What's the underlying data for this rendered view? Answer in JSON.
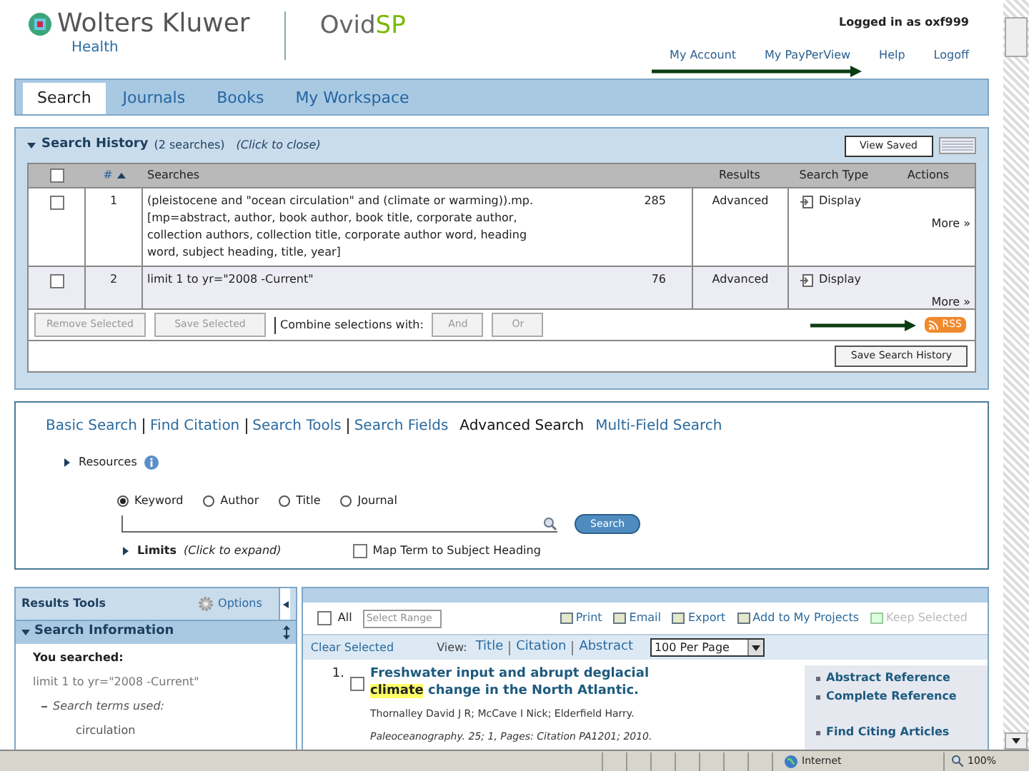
{
  "header": {
    "brand": "Wolters Kluwer",
    "division": "Health",
    "product": {
      "name": "Ovid",
      "suffix": "SP"
    },
    "logged_in": "Logged in as oxf999",
    "links": [
      "My Account",
      "My PayPerView",
      "Help",
      "Logoff"
    ]
  },
  "tabs": [
    {
      "label": "Search",
      "selected": true
    },
    {
      "label": "Journals",
      "selected": false
    },
    {
      "label": "Books",
      "selected": false
    },
    {
      "label": "My Workspace",
      "selected": false
    }
  ],
  "search_history": {
    "select_all_checked": false,
    "title": "Search History",
    "count": "(2 searches)",
    "hint": "(Click to close)",
    "view_saved": "View Saved",
    "columns": [
      "#",
      "Searches",
      "Results",
      "Search Type",
      "Actions"
    ],
    "rows": [
      {
        "checked": false,
        "number": "1",
        "search": "(pleistocene and \"ocean circulation\" and (climate or warming)).mp. [mp=abstract, author, book author, book title, corporate author, collection authors, collection title, corporate author word, heading word, subject heading, title, year]",
        "results": "285",
        "type": "Advanced",
        "action": "Display",
        "more": "More »"
      },
      {
        "checked": false,
        "number": "2",
        "search": "limit 1 to yr=\"2008 -Current\"",
        "results": "76",
        "type": "Advanced",
        "action": "Display",
        "more": "More »"
      }
    ],
    "buttons": [
      "Remove Selected",
      "Save Selected"
    ],
    "combine_label": "Combine selections with:",
    "combine_buttons": [
      "And",
      "Or"
    ],
    "rss": "RSS",
    "save_history": "Save Search History"
  },
  "search": {
    "modes": [
      {
        "label": "Basic Search",
        "selected": false
      },
      {
        "label": "Find Citation",
        "selected": false
      },
      {
        "label": "Search Tools",
        "selected": false
      },
      {
        "label": "Search Fields",
        "selected": false
      },
      {
        "label": "Advanced Search",
        "selected": true
      },
      {
        "label": "Multi-Field Search",
        "selected": false
      }
    ],
    "resources": "Resources",
    "fields": [
      {
        "label": "Keyword",
        "selected": true
      },
      {
        "label": "Author",
        "selected": false
      },
      {
        "label": "Title",
        "selected": false
      },
      {
        "label": "Journal",
        "selected": false
      }
    ],
    "button": "Search",
    "limits": "Limits",
    "limits_hint": "(Click to expand)",
    "map_term": {
      "label": "Map Term to Subject Heading",
      "checked": false
    }
  },
  "results_tools": {
    "title": "Results Tools",
    "options": "Options",
    "section": "Search Information",
    "you_searched": "You searched:",
    "query": "limit 1 to yr=\"2008 -Current\"",
    "terms_label": "Search terms used:",
    "terms": [
      "circulation"
    ]
  },
  "results": {
    "all_checked": false,
    "all": "All",
    "range_placeholder": "Select Range",
    "actions": [
      {
        "label": "Print",
        "disabled": false
      },
      {
        "label": "Email",
        "disabled": false
      },
      {
        "label": "Export",
        "disabled": false
      },
      {
        "label": "Add to My Projects",
        "disabled": false
      },
      {
        "label": "Keep Selected",
        "disabled": true
      }
    ],
    "clear": "Clear Selected",
    "view_label": "View:",
    "views": [
      "Title",
      "Citation",
      "Abstract"
    ],
    "per_page": "100 Per Page",
    "items": [
      {
        "number": "1.",
        "checked": false,
        "title_parts": [
          {
            "text": "Freshwater input and abrupt deglacial ",
            "highlighted": false
          },
          {
            "text": "climate",
            "highlighted": true
          },
          {
            "text": " change in the North Atlantic.",
            "highlighted": false
          }
        ],
        "authors": "Thornalley David J R; McCave I Nick; Elderfield Harry.",
        "source": "Paleoceanography. 25; 1, Pages: Citation PA1201; 2010.",
        "links": [
          "Abstract Reference",
          "Complete Reference",
          "Find Citing Articles"
        ]
      }
    ]
  },
  "status_bar": {
    "zone": "Internet",
    "zoom": "100%"
  }
}
